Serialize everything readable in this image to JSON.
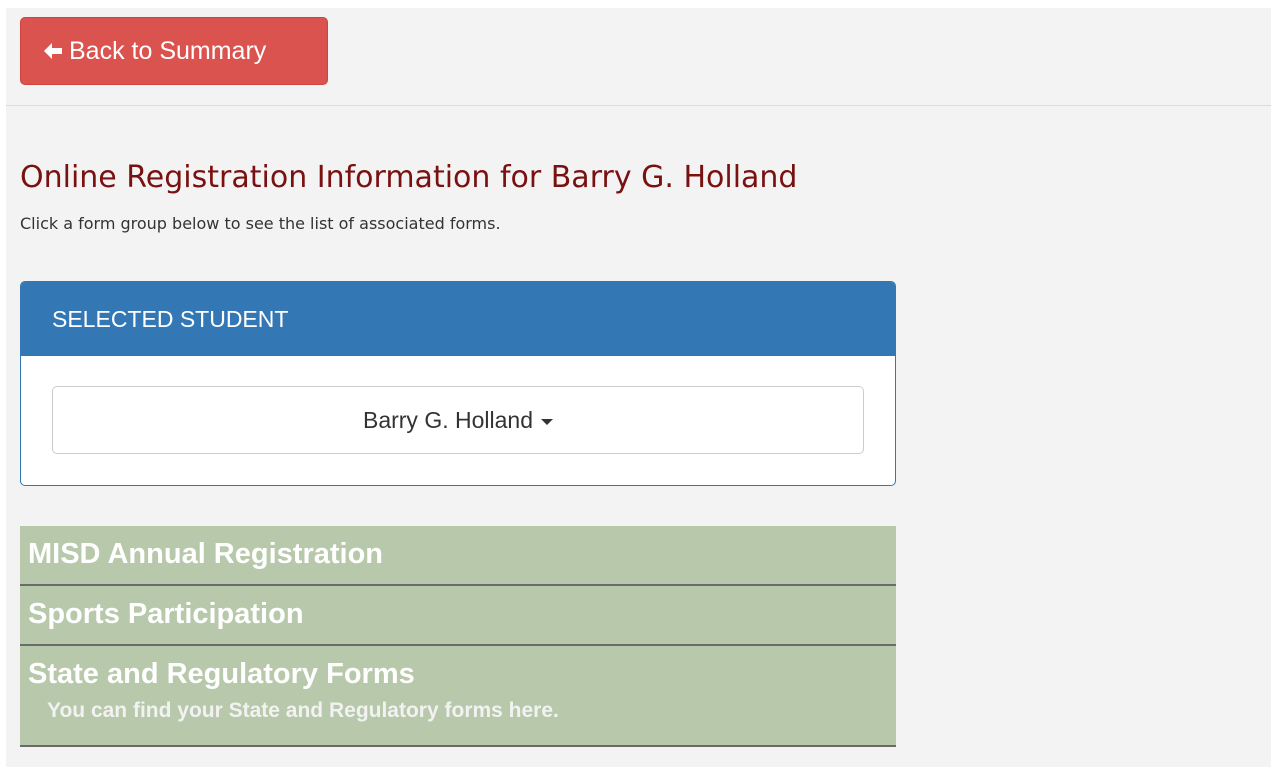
{
  "back_button": {
    "label": "Back to Summary",
    "icon": "arrow-left-icon"
  },
  "header": {
    "title": "Online Registration Information for Barry G. Holland",
    "subtitle": "Click a form group below to see the list of associated forms."
  },
  "student_panel": {
    "heading": "SELECTED STUDENT",
    "selected_student": "Barry G. Holland",
    "dropdown_icon": "caret-down-icon"
  },
  "form_groups": [
    {
      "title": "MISD Annual Registration",
      "description": ""
    },
    {
      "title": "Sports Participation",
      "description": ""
    },
    {
      "title": "State and Regulatory Forms",
      "description": "You can find your State and Regulatory forms here."
    }
  ],
  "colors": {
    "back_button": "#db534f",
    "title": "#7a1111",
    "panel_heading": "#3378b5",
    "group_background": "#b7c8ab"
  }
}
